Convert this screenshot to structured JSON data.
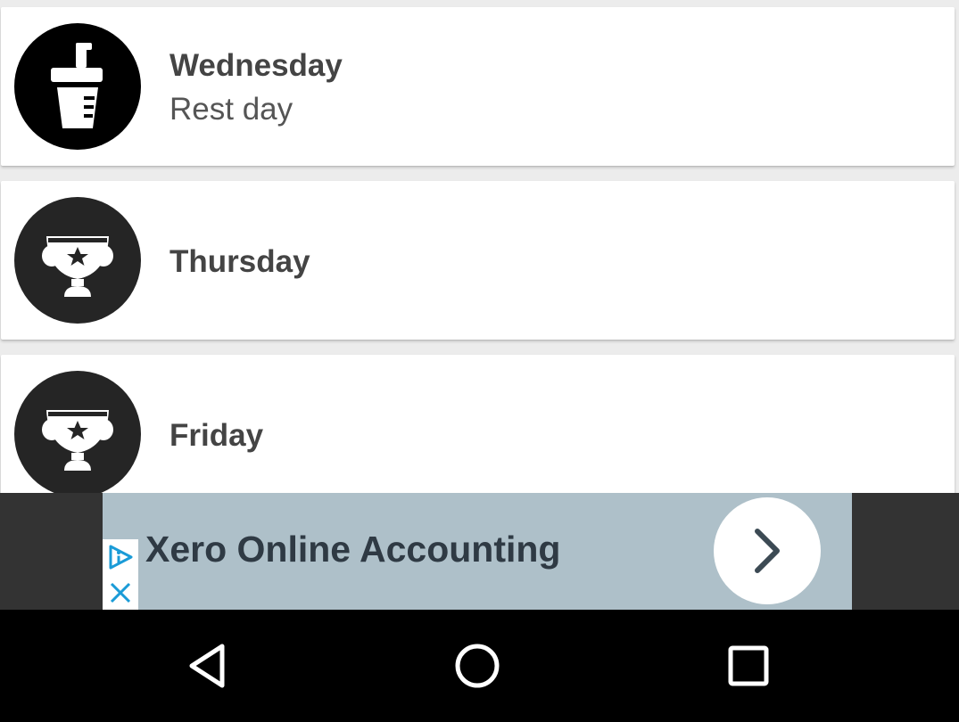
{
  "schedule": {
    "items": [
      {
        "day": "Wednesday",
        "subtitle": "Rest day",
        "icon": "drink-cup-icon"
      },
      {
        "day": "Thursday",
        "subtitle": "",
        "icon": "trophy-icon"
      },
      {
        "day": "Friday",
        "subtitle": "",
        "icon": "trophy-icon"
      }
    ]
  },
  "ad": {
    "text": "Xero Online Accounting",
    "info_icon": "ad-choices-icon",
    "close_icon": "close-icon",
    "action_icon": "chevron-right-icon"
  },
  "navigation": {
    "back_icon": "back-triangle-icon",
    "home_icon": "home-circle-icon",
    "recents_icon": "recents-square-icon"
  },
  "colors": {
    "ad_background": "#aec0c9",
    "ad_text": "#2f3a44",
    "ad_icon_blue": "#1a9bd7"
  }
}
